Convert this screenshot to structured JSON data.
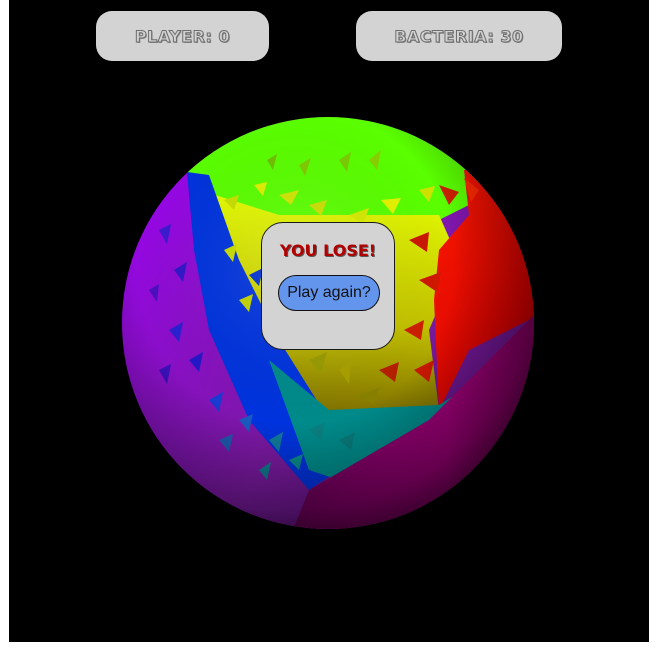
{
  "hud": {
    "player_score": "PLAYER: 0",
    "bacteria_count": "BACTERIA: 30"
  },
  "dialog": {
    "message": "YOU LOSE!",
    "play_again_label": "Play again?"
  },
  "colors": {
    "background": "#000000",
    "hud_box": "#d3d3d3",
    "lose_text": "#b00000",
    "button": "#6495ed",
    "region_green": "#5aff00",
    "region_red": "#ff0000",
    "region_purple": "#9a00c8",
    "region_blue": "#0030e0",
    "region_yellow": "#d8e800",
    "region_teal": "#008a8a",
    "region_magenta": "#8a0060"
  }
}
